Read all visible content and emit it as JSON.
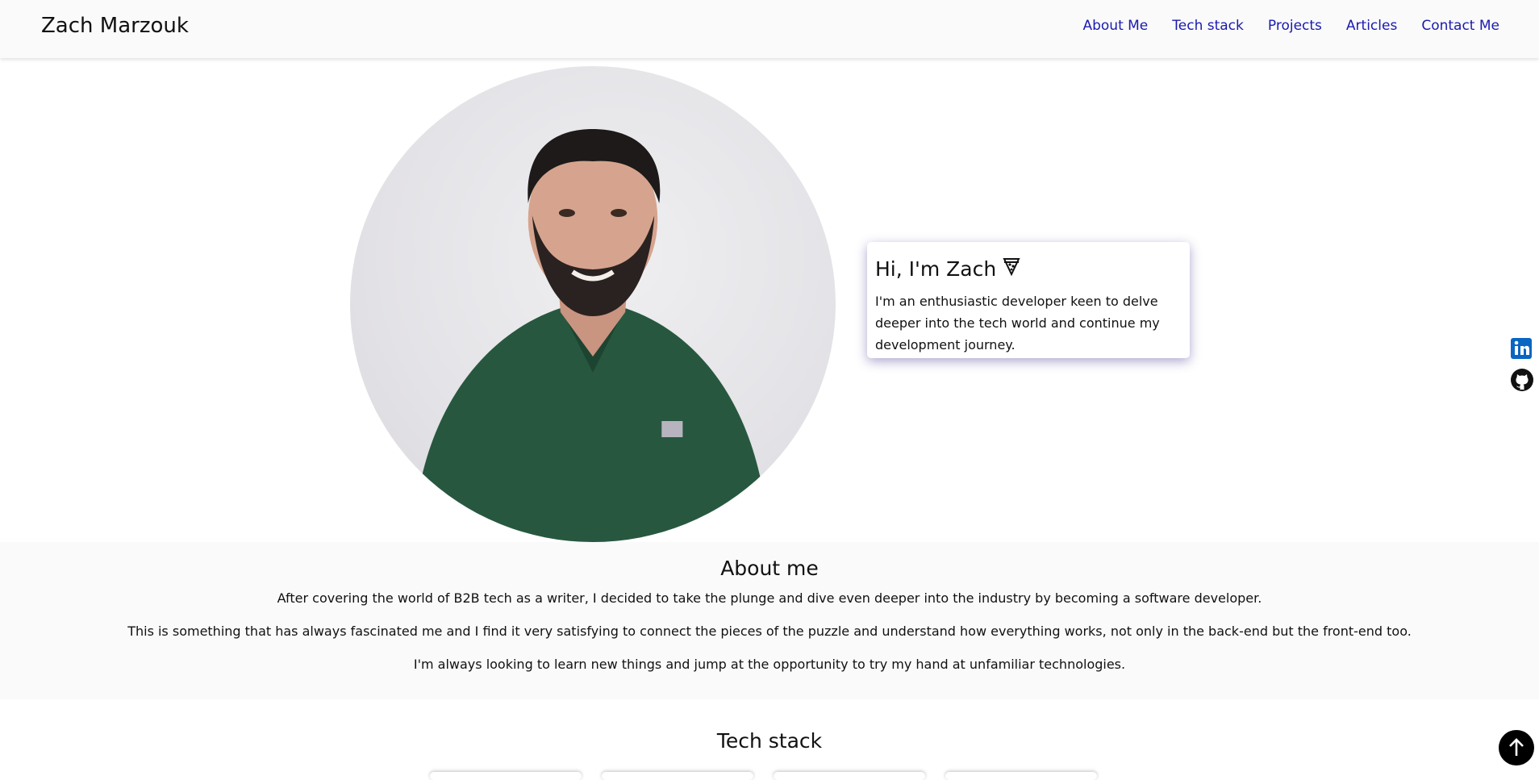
{
  "header": {
    "brand": "Zach Marzouk",
    "nav": [
      "About Me",
      "Tech stack",
      "Projects",
      "Articles",
      "Contact Me"
    ]
  },
  "hero": {
    "title": "Hi, I'm Zach",
    "emoji_icon": "pizza-icon",
    "text": "I'm an enthusiastic developer keen to delve deeper into the tech world and continue my development journey."
  },
  "about": {
    "title": "About me",
    "paragraphs": [
      "After covering the world of B2B tech as a writer, I decided to take the plunge and dive even deeper into the industry by becoming a software developer.",
      "This is something that has always fascinated me and I find it very satisfying to connect the pieces of the puzzle and understand how everything works, not only in the back-end but the front-end too.",
      "I'm always looking to learn new things and jump at the opportunity to try my hand at unfamiliar technologies."
    ]
  },
  "tech": {
    "title": "Tech stack"
  },
  "social": {
    "items": [
      "linkedin-icon",
      "github-icon"
    ]
  },
  "colors": {
    "nav_link": "#1a1ab0",
    "linkedin": "#0a66c2"
  }
}
